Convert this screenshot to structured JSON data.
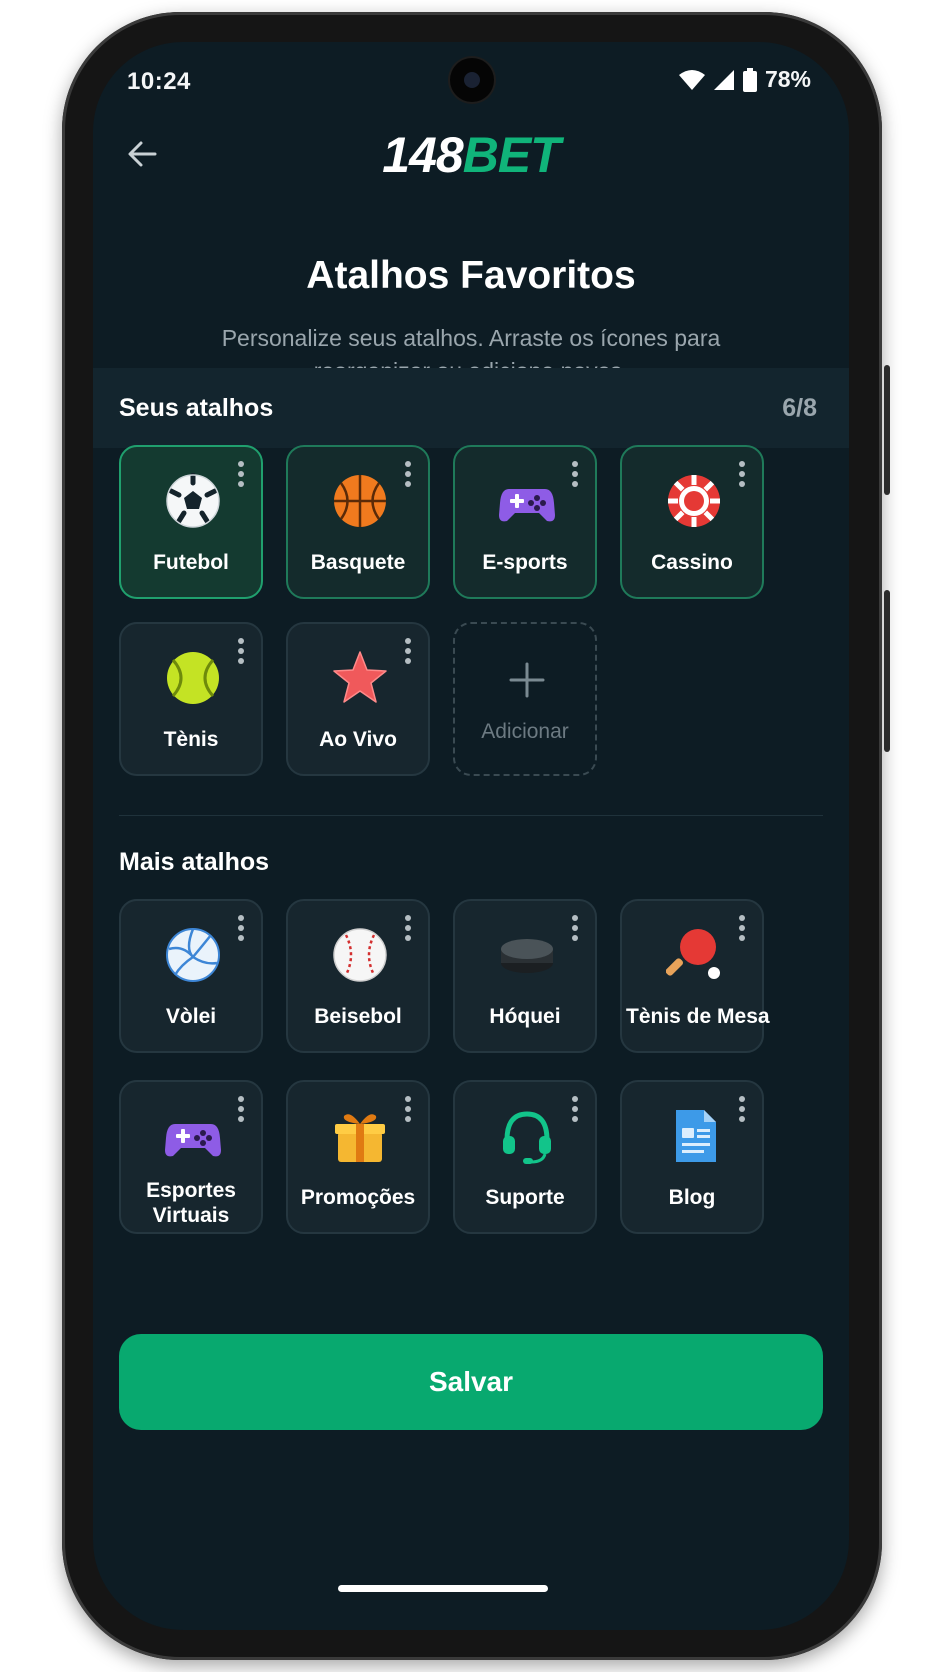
{
  "status_bar": {
    "time": "10:24",
    "battery": "78%"
  },
  "header": {
    "logo_number": "148",
    "logo_word": "BET",
    "title": "Atalhos Favoritos",
    "subtitle": "Personalize seus atalhos. Arraste os ícones para reorganizar ou adicione novos."
  },
  "favorites": {
    "title": "Seus atalhos",
    "count": "6/8",
    "items": [
      {
        "label": "Futebol",
        "icon": "soccer-ball-icon"
      },
      {
        "label": "Basquete",
        "icon": "basketball-icon"
      },
      {
        "label": "E-sports",
        "icon": "gamepad-icon"
      },
      {
        "label": "Cassino",
        "icon": "casino-chip-icon"
      },
      {
        "label": "Tènis",
        "icon": "tennis-ball-icon"
      },
      {
        "label": "Ao Vivo",
        "icon": "star-icon"
      }
    ],
    "add_label": "Adicionar"
  },
  "more": {
    "title": "Mais atalhos",
    "items": [
      {
        "label": "Vòlei",
        "icon": "volleyball-icon"
      },
      {
        "label": "Beisebol",
        "icon": "baseball-icon"
      },
      {
        "label": "Hóquei",
        "icon": "hockey-puck-icon"
      },
      {
        "label": "Tènis de Mesa",
        "icon": "ping-pong-icon"
      },
      {
        "label": "Esportes Virtuais",
        "icon": "virtual-gamepad-icon"
      },
      {
        "label": "Promoções",
        "icon": "gift-icon"
      },
      {
        "label": "Suporte",
        "icon": "headset-icon"
      },
      {
        "label": "Blog",
        "icon": "document-icon"
      }
    ]
  },
  "actions": {
    "save_label": "Salvar"
  },
  "colors": {
    "accent": "#08a96f",
    "background": "#0d1c24",
    "tile": "#17262e"
  }
}
